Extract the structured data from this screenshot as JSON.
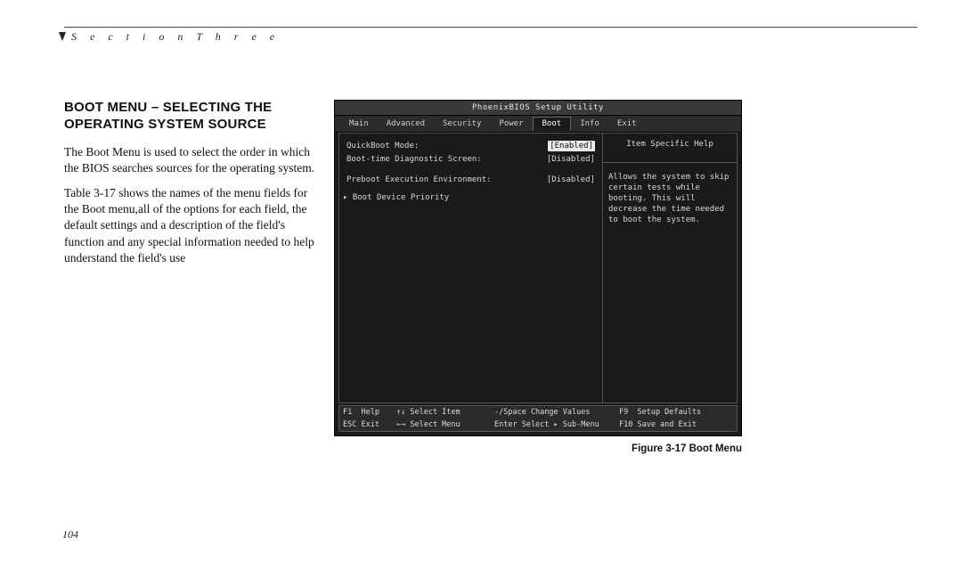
{
  "header": {
    "section_label": "S e c t i o n   T h r e e"
  },
  "left": {
    "heading_line1": "BOOT MENU – SELECTING THE",
    "heading_line2": "OPERATING SYSTEM SOURCE",
    "para1": "The Boot Menu is used to select the order  in  which the BIOS searches sources for the operating system.",
    "para2": "Table 3-17 shows the names of the menu fields for the Boot menu,all  of the options for each field, the default settings and a description of the field's function and any special information needed to help understand the field's use"
  },
  "bios": {
    "title": "PhoenixBIOS Setup Utility",
    "tabs": [
      "Main",
      "Advanced",
      "Security",
      "Power",
      "Boot",
      "Info",
      "Exit"
    ],
    "active_tab_index": 4,
    "rows": [
      {
        "label": "QuickBoot Mode:",
        "value": "[Enabled]",
        "selected": true
      },
      {
        "label": "Boot-time Diagnostic Screen:",
        "value": "[Disabled]",
        "selected": false
      }
    ],
    "rows2": [
      {
        "label": "Preboot Execution Environment:",
        "value": "[Disabled]",
        "selected": false
      }
    ],
    "sub_item": "▸ Boot Device Priority",
    "help_title": "Item Specific Help",
    "help_text": "Allows the system to skip certain tests while booting.  This will decrease the time needed to boot the system.",
    "footer": {
      "a1": "F1  Help",
      "a2": "↑↓ Select Item",
      "a3": "-/Space Change Values",
      "a4": "F9  Setup Defaults",
      "b1": "ESC Exit",
      "b2": "←→ Select Menu",
      "b3": "Enter Select ▸ Sub-Menu",
      "b4": "F10 Save and Exit"
    }
  },
  "caption": "Figure 3-17 Boot Menu",
  "page_number": "104"
}
